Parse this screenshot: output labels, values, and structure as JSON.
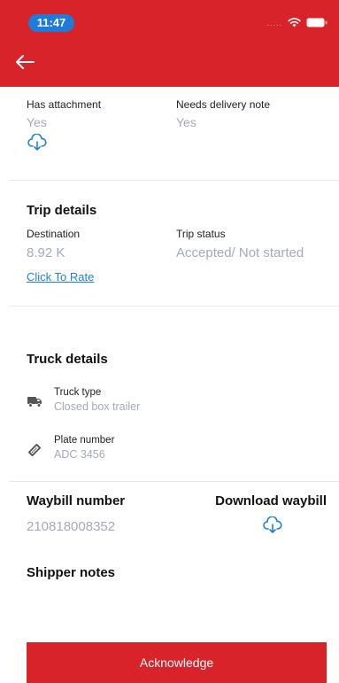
{
  "status_bar": {
    "time": "11:47",
    "signal": "....."
  },
  "header": {
    "accent": "#d8232a"
  },
  "attachment": {
    "has_attachment_label": "Has attachment",
    "has_attachment_value": "Yes",
    "delivery_note_label": "Needs delivery note",
    "delivery_note_value": "Yes"
  },
  "trip": {
    "title": "Trip details",
    "destination_label": "Destination",
    "destination_value": "8.92 K",
    "status_label": "Trip status",
    "status_value": "Accepted/ Not started",
    "rate_link": "Click To Rate"
  },
  "truck": {
    "title": "Truck details",
    "type_label": "Truck type",
    "type_value": "Closed box trailer",
    "plate_label": "Plate number",
    "plate_value": "ADC 3456"
  },
  "waybill": {
    "number_label": "Waybill number",
    "number_value": "210818008352",
    "download_label": "Download waybill"
  },
  "shipper": {
    "title": "Shipper notes"
  },
  "actions": {
    "acknowledge": "Acknowledge"
  },
  "icons": {
    "back": "arrow-left-icon",
    "cloud": "cloud-download-icon",
    "truck": "truck-icon",
    "plate": "tag-icon"
  }
}
